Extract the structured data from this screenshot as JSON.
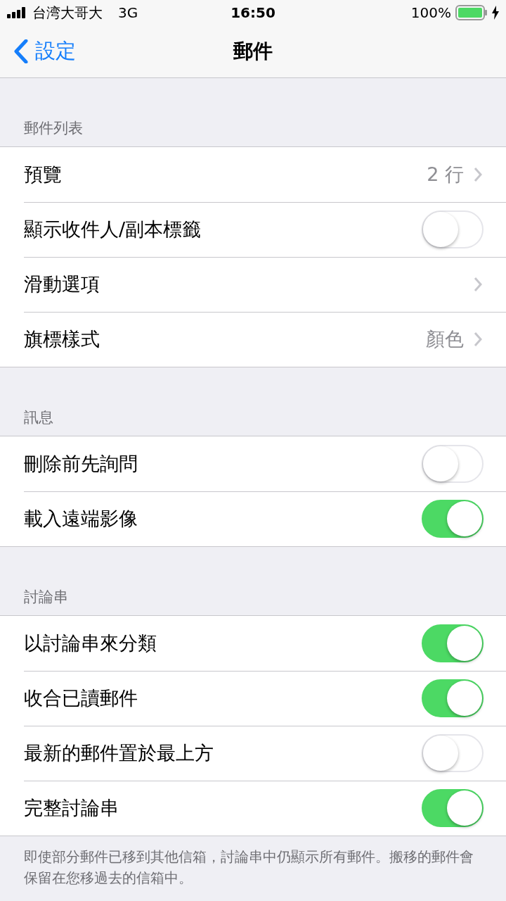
{
  "status_bar": {
    "carrier": "台湾大哥大",
    "network": "3G",
    "time": "16:50",
    "battery": "100%"
  },
  "nav": {
    "back": "設定",
    "title": "郵件"
  },
  "sections": [
    {
      "header": "郵件列表",
      "rows": [
        {
          "kind": "detail",
          "label": "預覽",
          "value": "2 行"
        },
        {
          "kind": "toggle",
          "label": "顯示收件人/副本標籤",
          "on": false
        },
        {
          "kind": "detail",
          "label": "滑動選項"
        },
        {
          "kind": "detail",
          "label": "旗標樣式",
          "value": "顏色"
        }
      ]
    },
    {
      "header": "訊息",
      "rows": [
        {
          "kind": "toggle",
          "label": "刪除前先詢問",
          "on": false
        },
        {
          "kind": "toggle",
          "label": "載入遠端影像",
          "on": true
        }
      ]
    },
    {
      "header": "討論串",
      "rows": [
        {
          "kind": "toggle",
          "label": "以討論串來分類",
          "on": true
        },
        {
          "kind": "toggle",
          "label": "收合已讀郵件",
          "on": true
        },
        {
          "kind": "toggle",
          "label": "最新的郵件置於最上方",
          "on": false
        },
        {
          "kind": "toggle",
          "label": "完整討論串",
          "on": true
        }
      ],
      "footer": "即使部分郵件已移到其他信箱，討論串中仍顯示所有郵件。搬移的郵件會保留在您移過去的信箱中。"
    }
  ]
}
